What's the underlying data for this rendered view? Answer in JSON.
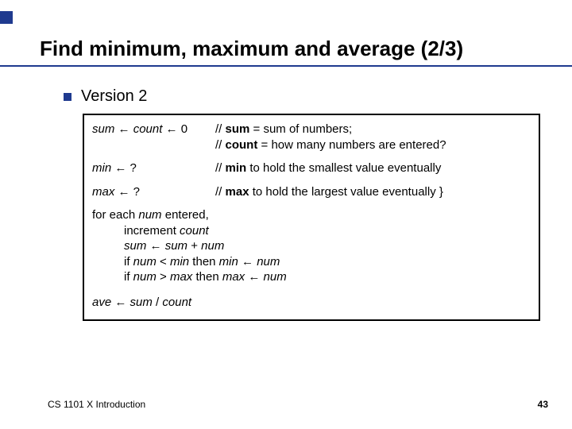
{
  "title": "Find minimum, maximum and average (2/3)",
  "heading": "Version 2",
  "rows": [
    {
      "left_html": "<span class='it'>sum</span> ← <span class='it'>count</span> ← 0",
      "right_html": "// <span class='bd'>sum</span> = sum of numbers;<br>// <span class='bd'>count</span> = how many numbers are entered?"
    },
    {
      "left_html": "<span class='it'>min</span> ← ?",
      "right_html": "// <span class='bd'>min</span> to hold the smallest value eventually"
    },
    {
      "left_html": "<span class='it'>max</span> ← ?",
      "right_html": "// <span class='bd'>max</span> to hold the largest value eventually }"
    }
  ],
  "loop": {
    "header": "for each <span class='it'>num</span> entered,",
    "lines": [
      "increment <span class='it'>count</span>",
      "<span class='it'>sum</span> ← <span class='it'>sum</span> + <span class='it'>num</span>",
      "if <span class='it'>num</span> &lt; <span class='it'>min</span> then <span class='it'>min</span> ← <span class='it'>num</span>",
      "if <span class='it'>num</span> &gt; <span class='it'>max</span> then <span class='it'>max</span> ← <span class='it'>num</span>"
    ]
  },
  "ave": "<span class='it'>ave</span> ← <span class='it'>sum</span> / <span class='it'>count</span>",
  "footer_left": "CS 1101 X Introduction",
  "footer_right": "43"
}
